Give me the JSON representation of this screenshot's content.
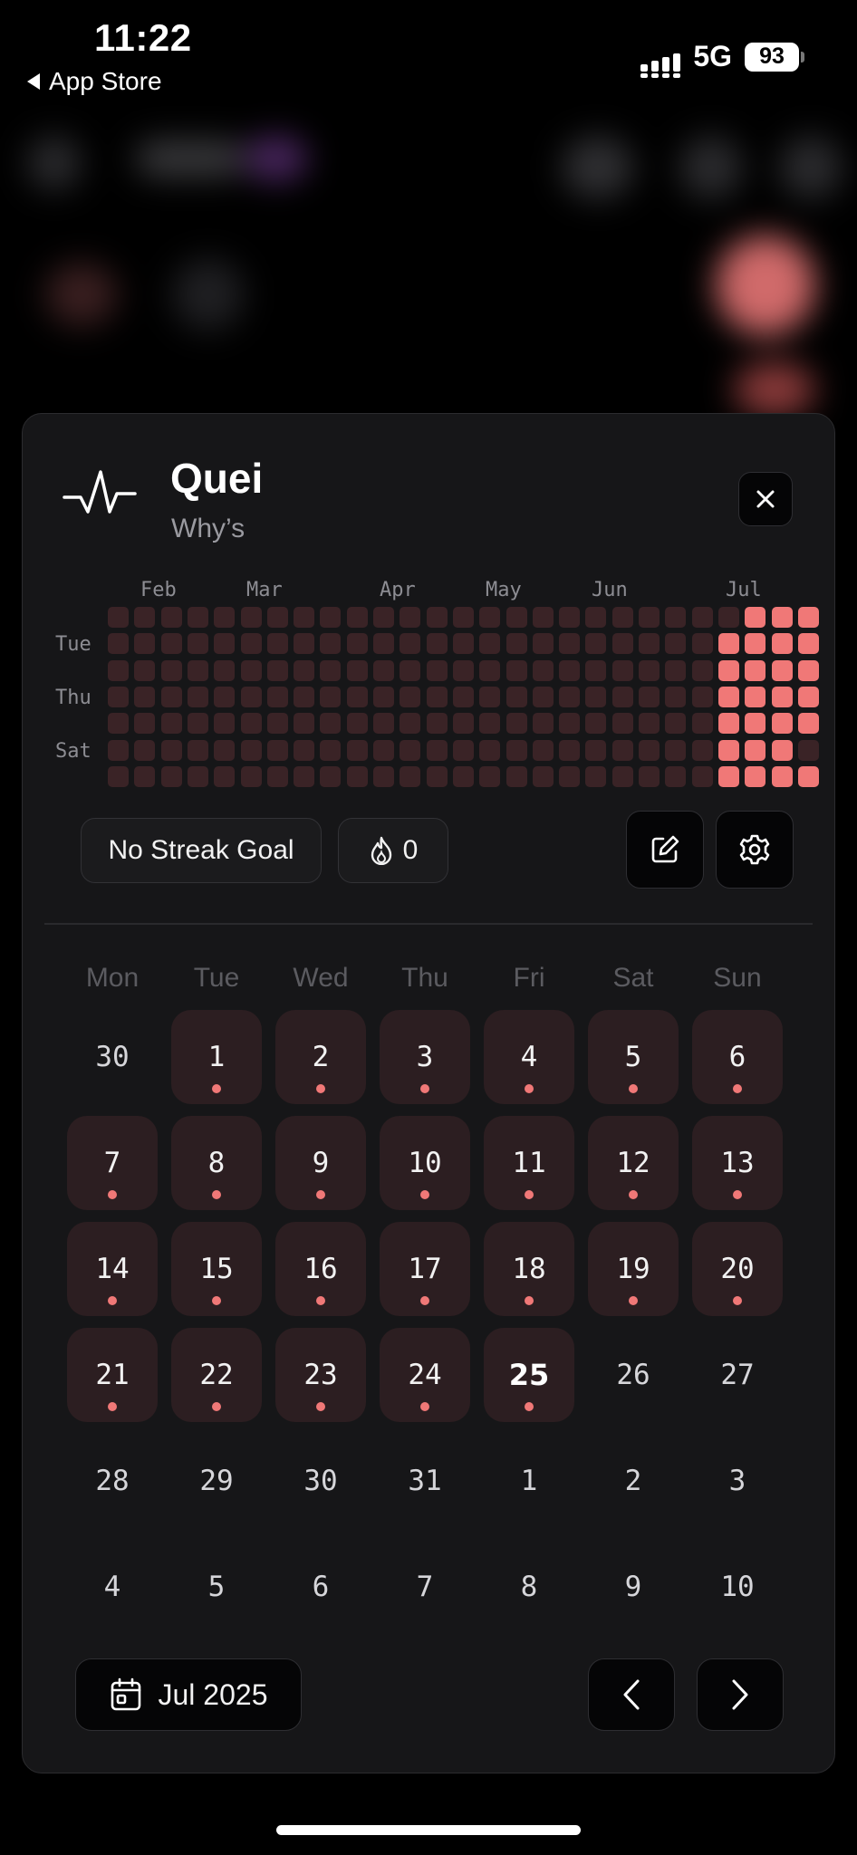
{
  "status_bar": {
    "time": "11:22",
    "back_label": "App Store",
    "network": "5G",
    "battery": "93"
  },
  "header": {
    "title": "Quei",
    "subtitle": "Why’s",
    "icon": "activity-pulse-icon"
  },
  "heatmap": {
    "months": [
      "Feb",
      "Mar",
      "Apr",
      "May",
      "Jun",
      "Jul"
    ],
    "day_labels": [
      "Tue",
      "Thu",
      "Sat"
    ],
    "columns": 27,
    "rows": 7,
    "active_columns_full": [
      24,
      25,
      26
    ],
    "active_column_partial": 23,
    "active_partial_rows": 5,
    "colors": {
      "inactive": "#3a2326",
      "active": "#f07877"
    }
  },
  "chips": {
    "streak_goal": "No Streak Goal",
    "streak_count": "0"
  },
  "actions": {
    "edit_icon": "edit-icon",
    "settings_icon": "gear-icon"
  },
  "calendar": {
    "weekdays": [
      "Mon",
      "Tue",
      "Wed",
      "Thu",
      "Fri",
      "Sat",
      "Sun"
    ],
    "weeks": [
      [
        {
          "d": "30",
          "a": false
        },
        {
          "d": "1",
          "a": true
        },
        {
          "d": "2",
          "a": true
        },
        {
          "d": "3",
          "a": true
        },
        {
          "d": "4",
          "a": true
        },
        {
          "d": "5",
          "a": true
        },
        {
          "d": "6",
          "a": true
        }
      ],
      [
        {
          "d": "7",
          "a": true
        },
        {
          "d": "8",
          "a": true
        },
        {
          "d": "9",
          "a": true
        },
        {
          "d": "10",
          "a": true
        },
        {
          "d": "11",
          "a": true
        },
        {
          "d": "12",
          "a": true
        },
        {
          "d": "13",
          "a": true
        }
      ],
      [
        {
          "d": "14",
          "a": true
        },
        {
          "d": "15",
          "a": true
        },
        {
          "d": "16",
          "a": true
        },
        {
          "d": "17",
          "a": true
        },
        {
          "d": "18",
          "a": true
        },
        {
          "d": "19",
          "a": true
        },
        {
          "d": "20",
          "a": true
        }
      ],
      [
        {
          "d": "21",
          "a": true
        },
        {
          "d": "22",
          "a": true
        },
        {
          "d": "23",
          "a": true
        },
        {
          "d": "24",
          "a": true
        },
        {
          "d": "25",
          "a": true,
          "today": true
        },
        {
          "d": "26",
          "a": false
        },
        {
          "d": "27",
          "a": false
        }
      ],
      [
        {
          "d": "28",
          "a": false
        },
        {
          "d": "29",
          "a": false
        },
        {
          "d": "30",
          "a": false
        },
        {
          "d": "31",
          "a": false
        },
        {
          "d": "1",
          "a": false
        },
        {
          "d": "2",
          "a": false
        },
        {
          "d": "3",
          "a": false
        }
      ],
      [
        {
          "d": "4",
          "a": false
        },
        {
          "d": "5",
          "a": false
        },
        {
          "d": "6",
          "a": false
        },
        {
          "d": "7",
          "a": false
        },
        {
          "d": "8",
          "a": false
        },
        {
          "d": "9",
          "a": false
        },
        {
          "d": "10",
          "a": false
        }
      ]
    ],
    "month_label": "Jul 2025",
    "accent": "#f07877"
  }
}
